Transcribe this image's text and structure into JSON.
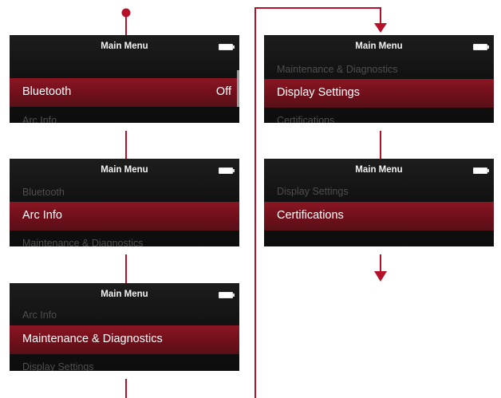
{
  "screens": [
    {
      "title": "Main Menu",
      "above": "",
      "selected": "Bluetooth",
      "selected_value": "Off",
      "below": "Arc Info"
    },
    {
      "title": "Main Menu",
      "above": "Bluetooth",
      "selected": "Arc Info",
      "selected_value": "",
      "below": "Maintenance & Diagnostics"
    },
    {
      "title": "Main Menu",
      "above": "Arc Info",
      "selected": "Maintenance & Diagnostics",
      "selected_value": "",
      "below": "Display Settings"
    },
    {
      "title": "Main Menu",
      "above": "Maintenance & Diagnostics",
      "selected": "Display Settings",
      "selected_value": "",
      "below": "Certifications"
    },
    {
      "title": "Main Menu",
      "above": "Display Settings",
      "selected": "Certifications",
      "selected_value": "",
      "below": ""
    }
  ],
  "colors": {
    "connector": "#b5122a",
    "highlight": "#7a1320",
    "screen_bg": "#111111",
    "dim_text": "#4e4e4e"
  }
}
